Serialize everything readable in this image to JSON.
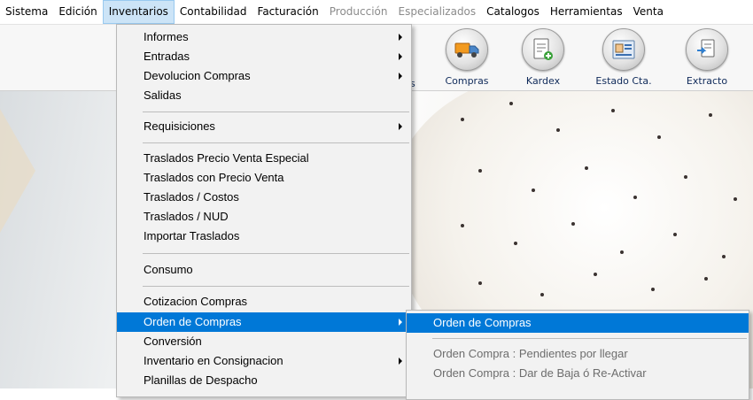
{
  "menubar": {
    "items": [
      {
        "label": "Sistema"
      },
      {
        "label": "Edición"
      },
      {
        "label": "Inventarios"
      },
      {
        "label": "Contabilidad"
      },
      {
        "label": "Facturación"
      },
      {
        "label": "Producción"
      },
      {
        "label": "Especializados"
      },
      {
        "label": "Catalogos"
      },
      {
        "label": "Herramientas"
      },
      {
        "label": "Venta"
      }
    ],
    "active": "Inventarios",
    "disabled": [
      "Producción",
      "Especializados"
    ]
  },
  "toolbar": {
    "partial_label": "s",
    "buttons": [
      {
        "label": "Compras",
        "icon": "truck-icon"
      },
      {
        "label": "Kardex",
        "icon": "kardex-document-icon"
      },
      {
        "label": "Estado Cta.",
        "icon": "account-statement-icon"
      },
      {
        "label": "Extracto",
        "icon": "extract-document-icon"
      }
    ]
  },
  "inventarios_menu": {
    "items": [
      {
        "label": "Informes",
        "has_submenu": true
      },
      {
        "label": "Entradas",
        "has_submenu": true
      },
      {
        "label": "Devolucion Compras",
        "has_submenu": true
      },
      {
        "label": "Salidas"
      },
      {
        "label": "Requisiciones",
        "has_submenu": true
      },
      {
        "label": "Traslados  Precio Venta Especial"
      },
      {
        "label": "Traslados con Precio Venta"
      },
      {
        "label": "Traslados  / Costos"
      },
      {
        "label": "Traslados / NUD"
      },
      {
        "label": "Importar Traslados"
      },
      {
        "label": "Consumo"
      },
      {
        "label": "Cotizacion Compras"
      },
      {
        "label": "Orden de Compras",
        "has_submenu": true,
        "highlighted": true
      },
      {
        "label": "Conversión"
      },
      {
        "label": "Inventario en Consignacion",
        "has_submenu": true
      },
      {
        "label": "Planillas de Despacho"
      }
    ]
  },
  "orden_submenu": {
    "items": [
      {
        "label": "Orden de Compras",
        "highlighted": true
      },
      {
        "label": "Orden Compra : Pendientes  por llegar",
        "disabled": true
      },
      {
        "label": "Orden Compra : Dar de  Baja ó  Re-Activar",
        "disabled": true
      }
    ]
  },
  "colors": {
    "highlight": "#0078d7",
    "active_menu_bg": "#cce4f7",
    "disabled_text": "#6d6d6d",
    "toolbar_label": "#0f2a5a"
  }
}
